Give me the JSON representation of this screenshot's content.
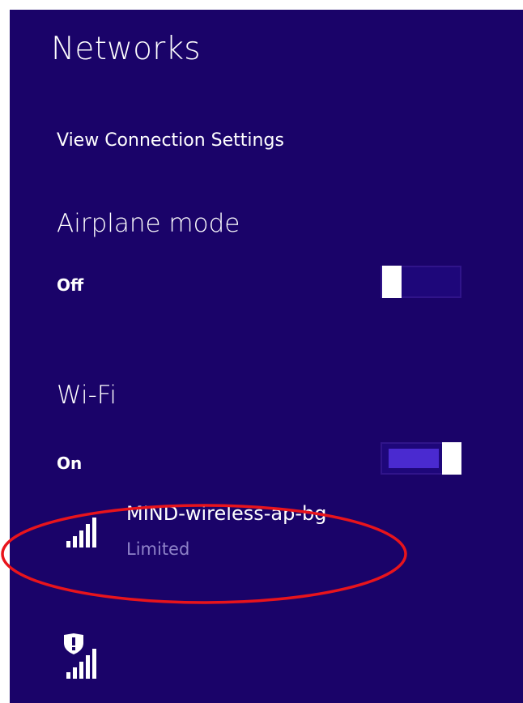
{
  "panel": {
    "title": "Networks",
    "view_settings": "View Connection Settings"
  },
  "airplane_mode": {
    "title": "Airplane mode",
    "state": "Off",
    "on": false
  },
  "wifi": {
    "title": "Wi-Fi",
    "state": "On",
    "on": true
  },
  "networks": [
    {
      "name": "MIND-wireless-ap-bg",
      "status": "Limited",
      "icon": "wifi-signal-icon"
    },
    {
      "name": "",
      "status": "",
      "icon": "secured-wifi-signal-icon"
    }
  ],
  "colors": {
    "panel_background": "#1a0369",
    "toggle_track_on": "#4a2ad0",
    "status_text": "#8e82c8",
    "highlight_ellipse": "#e8141c"
  }
}
